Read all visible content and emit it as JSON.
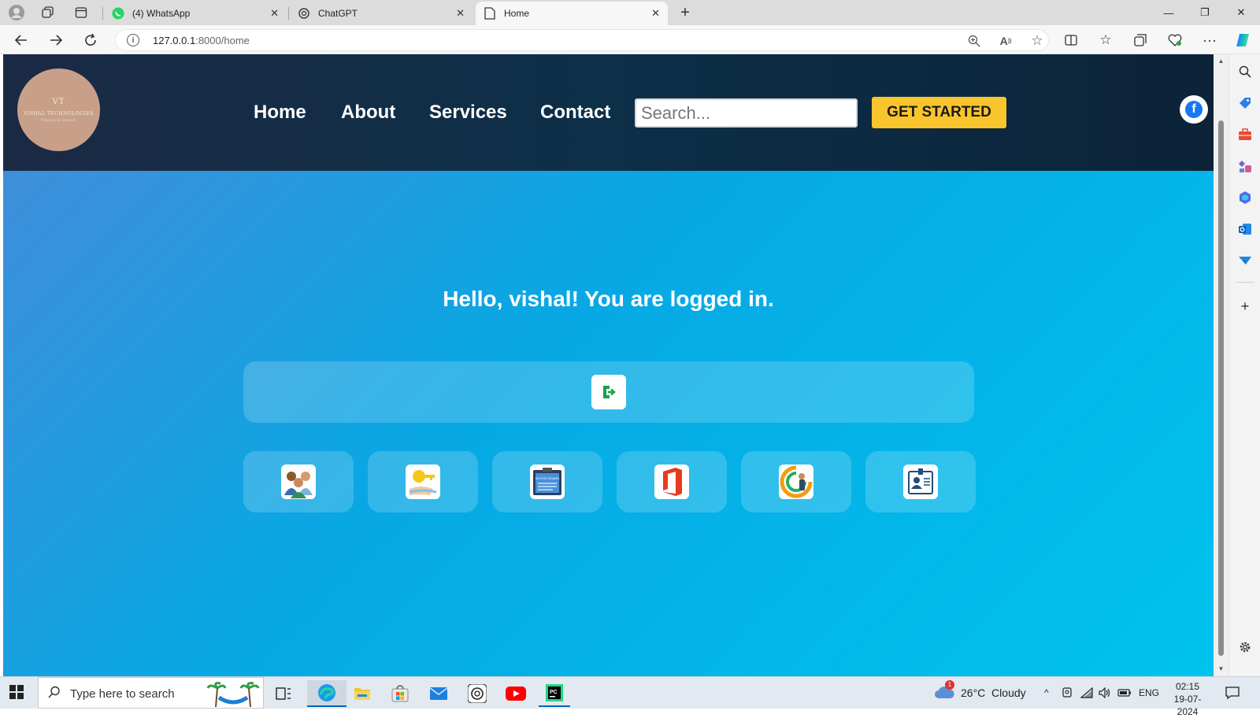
{
  "browser": {
    "tabs": [
      {
        "title": "(4) WhatsApp",
        "icon": "whatsapp-icon"
      },
      {
        "title": "ChatGPT",
        "icon": "chatgpt-icon"
      },
      {
        "title": "Home",
        "icon": "page-icon",
        "active": true
      }
    ],
    "url_host": "127.0.0.1",
    "url_path": ":8000/home"
  },
  "site": {
    "logo": {
      "mark": "VT",
      "name": "VISHAL TECHNOLOGIES",
      "sub": "TRUSTED SINCE"
    },
    "nav": [
      "Home",
      "About",
      "Services",
      "Contact"
    ],
    "search_placeholder": "Search...",
    "cta_label": "GET STARTED",
    "greeting": "Hello, vishal! You are logged in.",
    "tiles": [
      {
        "name": "team-app-icon"
      },
      {
        "name": "key-app-icon"
      },
      {
        "name": "notice-board-app-icon",
        "caption": "NOTICE BOARD"
      },
      {
        "name": "office-app-icon"
      },
      {
        "name": "profile-app-icon"
      },
      {
        "name": "employee-id-app-icon"
      }
    ]
  },
  "taskbar": {
    "search_placeholder": "Type here to search",
    "weather": "26°C  Cloudy",
    "weather_badge": "1",
    "language": "ENG",
    "time": "02:15",
    "date": "19-07-2024"
  },
  "colors": {
    "header_bg": "#0d2f48",
    "cta": "#f8c52c",
    "body_gradient_start": "#4a8ad8",
    "body_gradient_end": "#00c3ee"
  }
}
